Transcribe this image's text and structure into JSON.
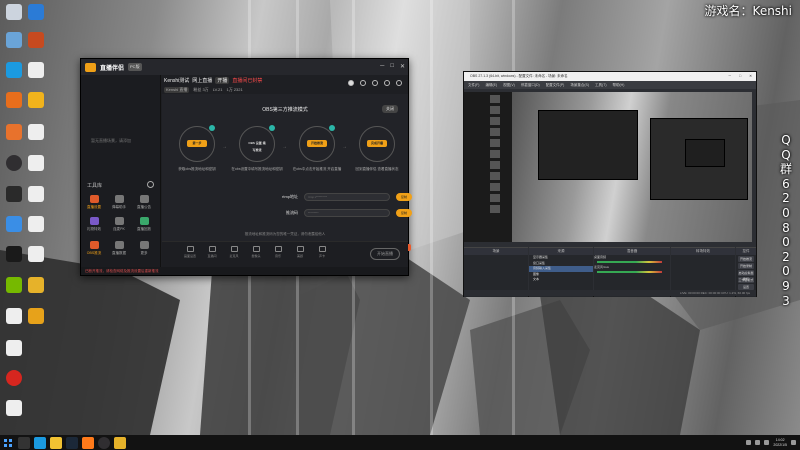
{
  "overlay": {
    "game_name": "游戏名：Kenshi",
    "qq_group": "QQ群620802093"
  },
  "stream_app": {
    "brand": "直播伴侣",
    "badge": "PC版",
    "user": {
      "name": "Kenshi测试",
      "tag_live": "网上直播",
      "tag2": "开播",
      "alert": "直播间已封禁",
      "id_label": "Kenshi 直播",
      "fans": "粉丝 3万",
      "level": "LV.21",
      "heat": "1万 2321"
    },
    "left_empty": "暂无直播场景，请添加",
    "tools_label": "工具库",
    "tools": [
      {
        "label": "直播设置"
      },
      {
        "label": "弹幕助手"
      },
      {
        "label": "直播公告"
      },
      {
        "label": "礼物特效"
      },
      {
        "label": "连麦PK"
      },
      {
        "label": "直播回放"
      },
      {
        "label": "OBS推流"
      },
      {
        "label": "直播数据"
      },
      {
        "label": "更多"
      }
    ],
    "guide_title": "OBS第三方推流模式",
    "close_btn": "关闭",
    "steps": [
      {
        "badge": "第一步",
        "caption": "获取obs推流地址和密钥"
      },
      {
        "badge": "OBS 设置 填写推流",
        "caption": "在obs设置中填写推流地址和密钥"
      },
      {
        "badge": "开始推流",
        "caption": "在obs中点击开始推流 开启直播"
      },
      {
        "badge": "完成开播",
        "caption": "回到直播伴侣 查看直播状态"
      }
    ],
    "rows": [
      {
        "label": "rtmp地址",
        "value": "rtmp://*********",
        "btn": "复制"
      },
      {
        "label": "推流码",
        "value": "*********",
        "btn": "复制"
      }
    ],
    "hint": "推流地址和推流码为您的唯一凭证，请勿泄露给他人",
    "float_btn": "收起OBS指引",
    "bottom_icons": [
      {
        "label": "画面设置"
      },
      {
        "label": "直播间"
      },
      {
        "label": "麦克风"
      },
      {
        "label": "摄像头"
      },
      {
        "label": "音乐"
      },
      {
        "label": "美颜"
      },
      {
        "label": "声卡"
      }
    ],
    "start_btn": "开始直播",
    "status": "已断开推流，请检查网络及推流设置后重新推流"
  },
  "obs": {
    "title": "OBS 27.1.3 (64-bit, windows) - 配置文件: 未命名 - 场景: 未命名",
    "menu": [
      "文件(F)",
      "编辑(E)",
      "视图(V)",
      "停靠窗口(D)",
      "配置文件(P)",
      "场景集合(S)",
      "工具(T)",
      "帮助(H)"
    ],
    "docks": {
      "scenes": "场景",
      "sources": "来源",
      "mixer": "混音器",
      "transitions": "转场特效",
      "controls": "控件"
    },
    "sources": [
      "显示器采集",
      "窗口采集",
      "音频输入采集",
      "图像",
      "文本"
    ],
    "mixer": [
      "桌面音频",
      "麦克风/Aux"
    ],
    "controls": [
      "开始推流",
      "开始录制",
      "启动虚拟摄像机",
      "工作室模式",
      "设置",
      "退出"
    ],
    "status": "LIVE: 00:00:00  REC: 00:00:00  CPU: 1.2%, 60.00 fps"
  },
  "taskbar": {
    "time": "14:02",
    "date": "2022/1/5"
  },
  "colors": {
    "accent": "#f0a017",
    "danger": "#e95a2c",
    "teal": "#2bb6a8"
  }
}
